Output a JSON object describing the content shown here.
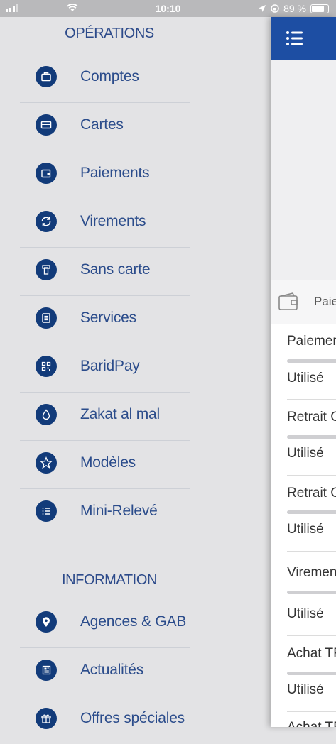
{
  "status": {
    "time": "10:10",
    "battery": "89 %"
  },
  "drawer": {
    "operations_title": "OPÉRATIONS",
    "operations": [
      {
        "label": "Comptes",
        "icon": "briefcase-icon"
      },
      {
        "label": "Cartes",
        "icon": "credit-card-icon"
      },
      {
        "label": "Paiements",
        "icon": "wallet-icon"
      },
      {
        "label": "Virements",
        "icon": "transfer-arrows-icon"
      },
      {
        "label": "Sans carte",
        "icon": "cash-withdraw-icon"
      },
      {
        "label": "Services",
        "icon": "document-icon"
      },
      {
        "label": "BaridPay",
        "icon": "qr-code-icon"
      },
      {
        "label": "Zakat al mal",
        "icon": "drop-icon"
      },
      {
        "label": "Modèles",
        "icon": "star-icon"
      },
      {
        "label": "Mini-Relevé",
        "icon": "list-icon"
      }
    ],
    "information_title": "INFORMATION",
    "information": [
      {
        "label": "Agences & GAB",
        "icon": "location-pin-icon"
      },
      {
        "label": "Actualités",
        "icon": "newspaper-icon"
      },
      {
        "label": "Offres spéciales",
        "icon": "gift-icon"
      }
    ]
  },
  "main": {
    "pay_header": "Paie",
    "limits": [
      {
        "title": "Paiemer",
        "used": "Utilisé"
      },
      {
        "title": "Retrait G",
        "used": "Utilisé"
      },
      {
        "title": "Retrait G",
        "used": "Utilisé"
      },
      {
        "title": "Virement",
        "used": "Utilisé"
      },
      {
        "title": "Achat TF",
        "used": "Utilisé"
      },
      {
        "title": "Achat TP"
      }
    ]
  }
}
